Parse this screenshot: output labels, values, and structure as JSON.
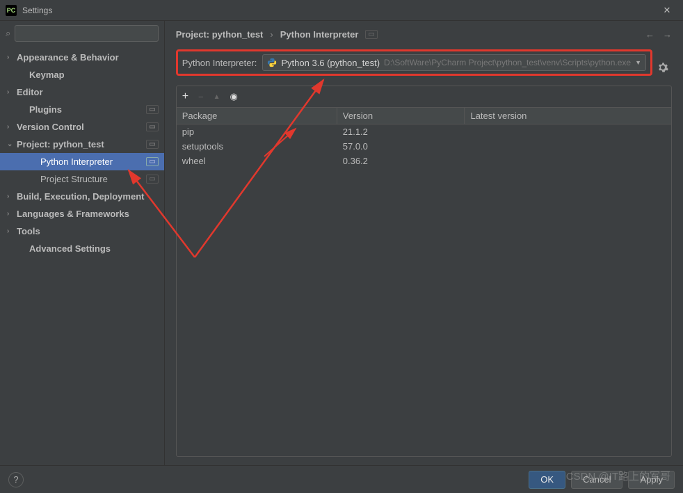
{
  "titlebar": {
    "app_icon_text": "PC",
    "title": "Settings"
  },
  "search": {
    "placeholder": "",
    "icon_glyph": "⌕"
  },
  "tree": {
    "items": [
      {
        "label": "Appearance & Behavior",
        "expandable": true,
        "bold": true,
        "level": 0
      },
      {
        "label": "Keymap",
        "expandable": false,
        "bold": true,
        "level": 1
      },
      {
        "label": "Editor",
        "expandable": true,
        "bold": true,
        "level": 0
      },
      {
        "label": "Plugins",
        "expandable": false,
        "bold": true,
        "level": 1,
        "tag": "▭"
      },
      {
        "label": "Version Control",
        "expandable": true,
        "bold": true,
        "level": 0,
        "tag": "▭"
      },
      {
        "label": "Project: python_test",
        "expandable": true,
        "expanded": true,
        "bold": true,
        "level": 0,
        "tag": "▭"
      },
      {
        "label": "Python Interpreter",
        "expandable": false,
        "bold": false,
        "level": 2,
        "tag": "▭",
        "selected": true
      },
      {
        "label": "Project Structure",
        "expandable": false,
        "bold": false,
        "level": 2,
        "tag": "▭"
      },
      {
        "label": "Build, Execution, Deployment",
        "expandable": true,
        "bold": true,
        "level": 0
      },
      {
        "label": "Languages & Frameworks",
        "expandable": true,
        "bold": true,
        "level": 0
      },
      {
        "label": "Tools",
        "expandable": true,
        "bold": true,
        "level": 0
      },
      {
        "label": "Advanced Settings",
        "expandable": false,
        "bold": true,
        "level": 1
      }
    ]
  },
  "breadcrumb": {
    "part1": "Project: python_test",
    "sep": "›",
    "part2": "Python Interpreter",
    "tag": "▭",
    "back": "←",
    "forward": "→"
  },
  "interpreter": {
    "label": "Python Interpreter:",
    "name": "Python 3.6 (python_test)",
    "path": "D:\\SoftWare\\PyCharm Project\\python_test\\venv\\Scripts\\python.exe",
    "dropdown_glyph": "▼"
  },
  "pkg_toolbar": {
    "add": "+",
    "remove": "−",
    "up": "▲",
    "eye": "◉"
  },
  "pkg_table": {
    "headers": [
      "Package",
      "Version",
      "Latest version"
    ],
    "rows": [
      {
        "name": "pip",
        "version": "21.1.2",
        "latest": ""
      },
      {
        "name": "setuptools",
        "version": "57.0.0",
        "latest": ""
      },
      {
        "name": "wheel",
        "version": "0.36.2",
        "latest": ""
      }
    ]
  },
  "footer": {
    "help": "?",
    "ok": "OK",
    "cancel": "Cancel",
    "apply": "Apply"
  },
  "watermark": "CSDN @IT路上的军哥"
}
